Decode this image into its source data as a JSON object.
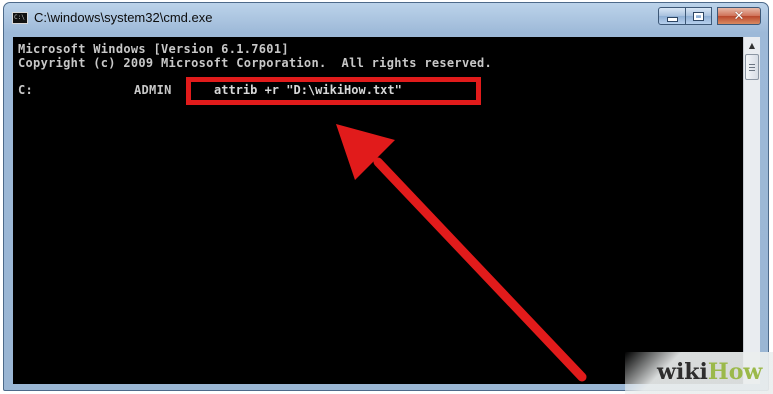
{
  "window": {
    "title": "C:\\windows\\system32\\cmd.exe",
    "icon": "cmd-icon",
    "icon_text": "C:\\",
    "controls": {
      "minimize": "minimize-icon",
      "maximize": "maximize-icon",
      "close": "close-icon",
      "close_glyph": "✕"
    }
  },
  "console": {
    "header_lines": [
      "Microsoft Windows [Version 6.1.7601]",
      "Copyright (c) 2009 Microsoft Corporation.  All rights reserved."
    ],
    "prompt": {
      "drive": "C:",
      "user": "ADMIN"
    },
    "command": "attrib +r \"D:\\wikiHow.txt\"",
    "text_color": "#c8c8c8",
    "background": "#000000"
  },
  "annotation": {
    "box_color": "#e11b1b",
    "arrow_color": "#e11b1b"
  },
  "scrollbar": {
    "up_arrow": "▲"
  },
  "watermark": {
    "part1": "wiki",
    "part2": "How"
  }
}
